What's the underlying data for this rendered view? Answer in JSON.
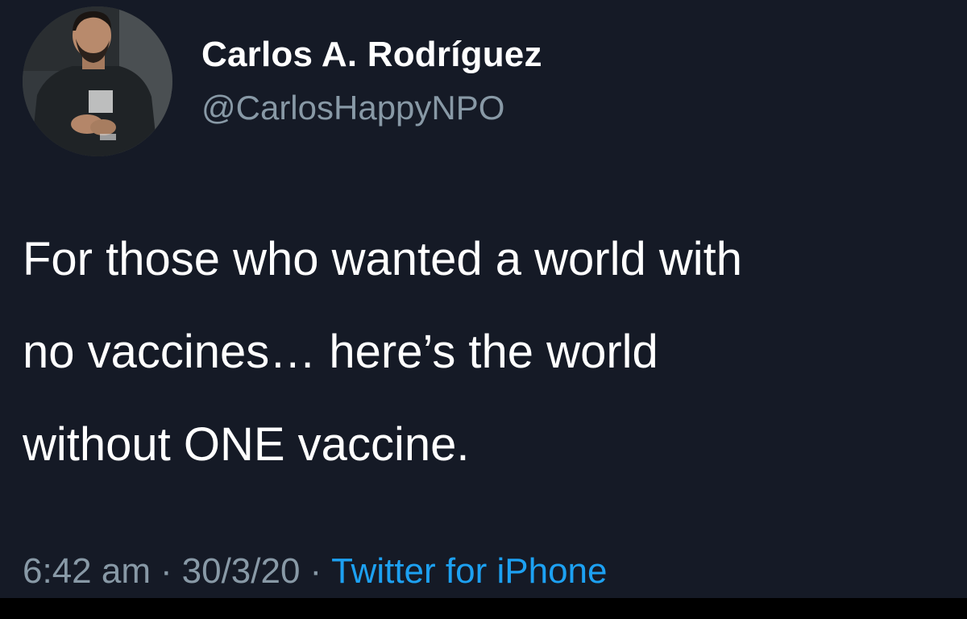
{
  "tweet": {
    "author": {
      "display_name": "Carlos A. Rodríguez",
      "handle": "@CarlosHappyNPO",
      "avatar_icon": "profile-photo"
    },
    "text_lines": [
      "For those who wanted a world with",
      "no vaccines… here’s the world",
      "without ONE vaccine."
    ],
    "meta": {
      "time": "6:42 am",
      "separator": "·",
      "date": "30/3/20",
      "source": "Twitter for iPhone"
    }
  },
  "colors": {
    "background": "#151a26",
    "text": "#ffffff",
    "muted": "#8899a6",
    "link": "#1da1f2",
    "bottom_bar": "#000000"
  }
}
